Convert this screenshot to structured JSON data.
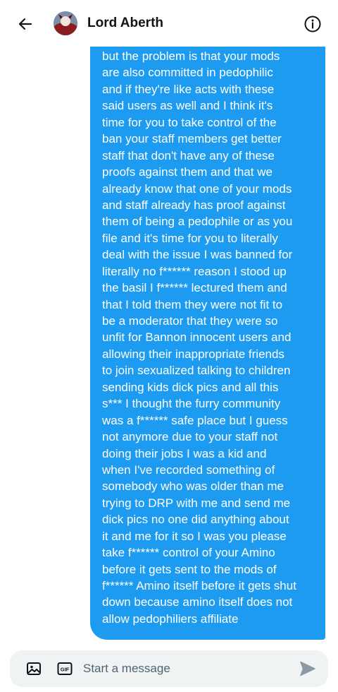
{
  "header": {
    "back_icon": "arrow-left-icon",
    "contact_name": "Lord Aberth",
    "info_icon": "info-circle-icon"
  },
  "message": {
    "sender": "self",
    "bubble_color": "#1d9bf0",
    "lines": [
      "but the problem is that your mods",
      "are also committed in pedophilic",
      "and if they're like acts with these",
      "said users as well and I think it's",
      "time for you to take control of the",
      "ban your staff members get better",
      "staff that don't have any of these",
      "proofs against them and that we",
      "already know that one of your mods",
      "and staff already has proof against",
      "them of being a pedophile or as you",
      "file and it's time for you to literally",
      "deal with the issue I was banned for",
      "literally no f****** reason I stood up",
      "the basil I f****** lectured them and",
      "that I told them they were not fit to",
      "be a moderator that they were so",
      "unfit for Bannon innocent users and",
      "allowing their inappropriate friends",
      "to join sexualized talking to children",
      "sending kids dick pics and all this",
      "s*** I thought the furry community",
      "was a f****** safe place but I guess",
      "not anymore due to your staff not",
      "doing their jobs I was a kid and",
      "when I've recorded something of",
      "somebody who was older than me",
      "trying to DRP with me and send me",
      "dick pics no one did anything about",
      "it and me for it so I was you please",
      "take f****** control of your Amino",
      "before it gets sent to the mods of",
      "f****** Amino itself before it gets shut",
      "down because amino itself does not",
      "allow pedophiliers affiliate"
    ]
  },
  "composer": {
    "media_icon": "image-icon",
    "gif_icon": "gif-icon",
    "placeholder": "Start a message",
    "value": "",
    "send_icon": "send-icon"
  },
  "colors": {
    "accent": "#1d9bf0",
    "composer_bg": "#eff3f4",
    "text_primary": "#0f1419",
    "text_secondary": "#536471"
  }
}
